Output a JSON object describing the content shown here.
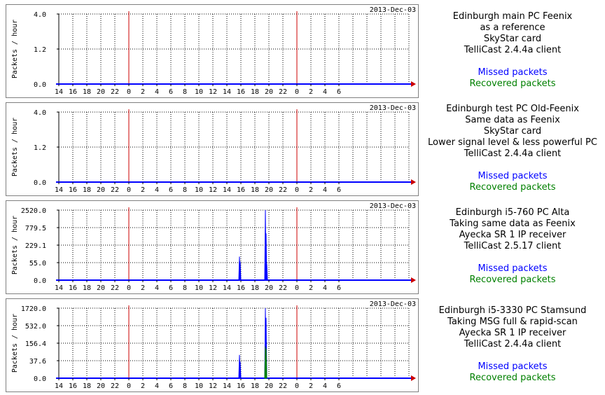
{
  "colors": {
    "missed": "#0000ff",
    "recovered": "#008000",
    "marker": "#cc0000",
    "frame": "#808080"
  },
  "legend": {
    "missed": "Missed packets",
    "recovered": "Recovered packets"
  },
  "chart_data": [
    {
      "type": "area",
      "date_label": "2013-Dec-03",
      "ylabel": "Packets / hour",
      "y_scale": "log",
      "y_ticks": [
        "0.0",
        "1.2",
        "4.0"
      ],
      "x_ticks": [
        "14",
        "16",
        "18",
        "20",
        "22",
        "0",
        "2",
        "4",
        "6",
        "8",
        "10",
        "12",
        "14",
        "16",
        "18",
        "20",
        "22",
        "0",
        "2",
        "4",
        "6"
      ],
      "midnight_markers": [
        "0",
        "0"
      ],
      "series": [
        {
          "name": "Missed packets",
          "points": []
        },
        {
          "name": "Recovered packets",
          "points": []
        }
      ],
      "description": [
        "Edinburgh main PC Feenix",
        "as a reference",
        "SkyStar card",
        "TelliCast 2.4.4a client"
      ]
    },
    {
      "type": "area",
      "date_label": "2013-Dec-03",
      "ylabel": "Packets / hour",
      "y_scale": "log",
      "y_ticks": [
        "0.0",
        "1.2",
        "4.0"
      ],
      "x_ticks": [
        "14",
        "16",
        "18",
        "20",
        "22",
        "0",
        "2",
        "4",
        "6",
        "8",
        "10",
        "12",
        "14",
        "16",
        "18",
        "20",
        "22",
        "0",
        "2",
        "4",
        "6"
      ],
      "midnight_markers": [
        "0",
        "0"
      ],
      "series": [
        {
          "name": "Missed packets",
          "points": []
        },
        {
          "name": "Recovered packets",
          "points": []
        }
      ],
      "description": [
        "Edinburgh test PC Old-Feenix",
        "Same data as Feenix",
        "SkyStar card",
        "Lower signal level & less powerful PC",
        "TelliCast 2.4.4a client"
      ]
    },
    {
      "type": "area",
      "date_label": "2013-Dec-03",
      "ylabel": "Packets / hour",
      "y_scale": "log",
      "y_ticks": [
        "0.0",
        "55.0",
        "229.1",
        "779.5",
        "2520.0"
      ],
      "x_ticks": [
        "14",
        "16",
        "18",
        "20",
        "22",
        "0",
        "2",
        "4",
        "6",
        "8",
        "10",
        "12",
        "14",
        "16",
        "18",
        "20",
        "22",
        "0",
        "2",
        "4",
        "6"
      ],
      "midnight_markers": [
        "0",
        "0"
      ],
      "series": [
        {
          "name": "Missed packets",
          "points": [
            [
              39.8,
              90
            ],
            [
              39.9,
              60
            ],
            [
              43.5,
              2520
            ],
            [
              43.6,
              520
            ],
            [
              43.7,
              40
            ]
          ]
        },
        {
          "name": "Recovered packets",
          "points": []
        }
      ],
      "description": [
        "Edinburgh i5-760 PC Alta",
        "Taking same data as Feenix",
        "Ayecka SR 1 IP receiver",
        "TelliCast 2.5.17 client"
      ]
    },
    {
      "type": "area",
      "date_label": "2013-Dec-03",
      "ylabel": "Packets / hour",
      "y_scale": "log",
      "y_ticks": [
        "0.0",
        "37.6",
        "156.4",
        "532.0",
        "1720.0"
      ],
      "x_ticks": [
        "14",
        "16",
        "18",
        "20",
        "22",
        "0",
        "2",
        "4",
        "6",
        "8",
        "10",
        "12",
        "14",
        "16",
        "18",
        "20",
        "22",
        "0",
        "2",
        "4",
        "6"
      ],
      "midnight_markers": [
        "0",
        "0"
      ],
      "series": [
        {
          "name": "Missed packets",
          "points": [
            [
              39.8,
              60
            ],
            [
              39.9,
              30
            ],
            [
              43.5,
              1720
            ],
            [
              43.6,
              900
            ]
          ]
        },
        {
          "name": "Recovered packets",
          "points": [
            [
              43.5,
              120
            ],
            [
              43.6,
              100
            ]
          ]
        }
      ],
      "description": [
        "Edinburgh i5-3330 PC Stamsund",
        "Taking MSG full & rapid-scan",
        "Ayecka SR 1 IP receiver",
        "TelliCast 2.4.4a client"
      ]
    }
  ]
}
